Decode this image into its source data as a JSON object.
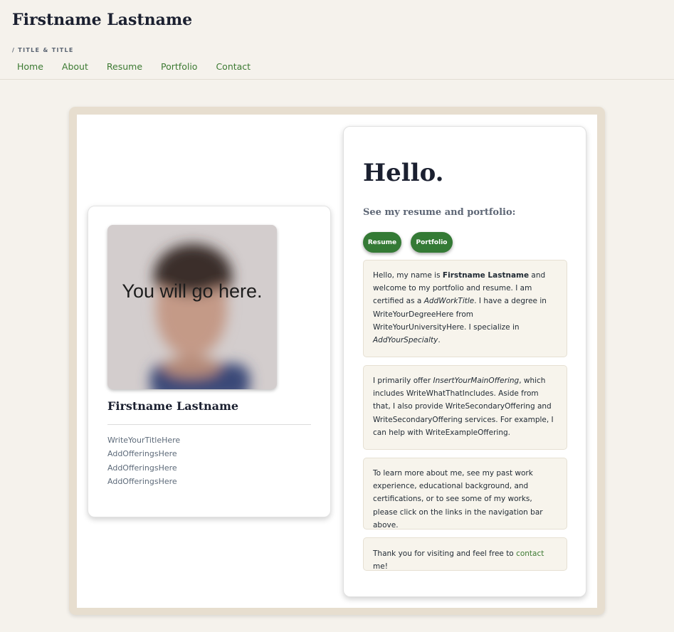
{
  "header": {
    "site_title": "Firstname Lastname",
    "subtitle": "/ TITLE & TITLE",
    "nav": [
      "Home",
      "About",
      "Resume",
      "Portfolio",
      "Contact"
    ]
  },
  "profile": {
    "photo_placeholder": "You will go here.",
    "name": "Firstname Lastname",
    "items": [
      "WriteYourTitleHere",
      "AddOfferingsHere",
      "AddOfferingsHere",
      "AddOfferingsHere"
    ]
  },
  "intro": {
    "greeting": "Hello.",
    "see_more": "See my resume and portfolio:",
    "buttons": {
      "resume": "Resume",
      "portfolio": "Portfolio"
    },
    "p1": {
      "a": "Hello, my name is ",
      "name": "Firstname Lastname",
      "b": " and welcome to my portfolio and resume. I am certified as a ",
      "work_title": "AddWorkTitle",
      "c": ". I have a degree in WriteYourDegreeHere from WriteYourUniversityHere. I specialize in ",
      "specialty": "AddYourSpecialty",
      "d": "."
    },
    "p2": {
      "a": "I primarily offer ",
      "main_offering": "InsertYourMainOffering",
      "b": ", which includes WriteWhatThatIncludes. Aside from that, I also provide WriteSecondaryOffering and WriteSecondaryOffering services. For example, I can help with WriteExampleOffering."
    },
    "p3": "To learn more about me, see my past work experience, educational background, and certifications, or to see some of my works, please click on the links in the navigation bar above.",
    "p4": {
      "a": "Thank you for visiting and feel free to ",
      "link": "contact",
      "b": " me!"
    }
  },
  "colors": {
    "background": "#f5f2ec",
    "frame": "#e7decf",
    "accent_green": "#347a35",
    "link_green": "#3c7a32",
    "paragraph_bg": "#f7f4ec"
  }
}
